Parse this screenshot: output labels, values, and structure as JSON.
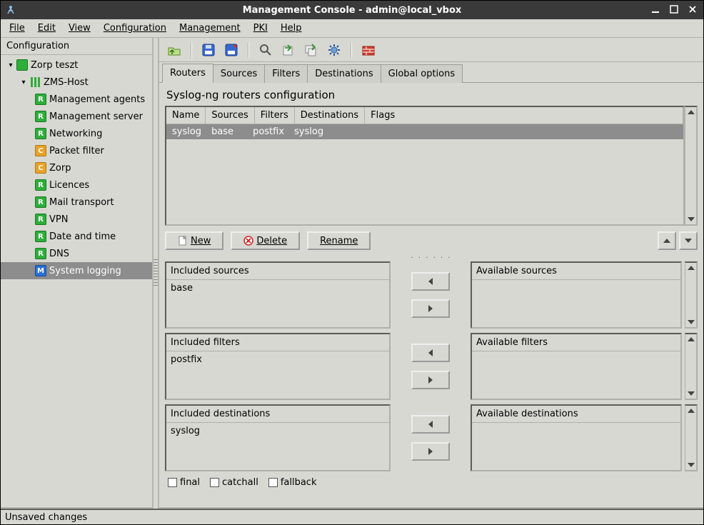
{
  "window_title": "Management Console - admin@local_vbox",
  "menubar": {
    "file": "File",
    "edit": "Edit",
    "view": "View",
    "configuration": "Configuration",
    "management": "Management",
    "pki": "PKI",
    "help": "Help"
  },
  "sidebar": {
    "header": "Configuration",
    "root": "Zorp teszt",
    "host": "ZMS-Host",
    "items": [
      {
        "icon": "R",
        "color": "green",
        "label": "Management agents"
      },
      {
        "icon": "R",
        "color": "green",
        "label": "Management server"
      },
      {
        "icon": "R",
        "color": "green",
        "label": "Networking"
      },
      {
        "icon": "C",
        "color": "orange",
        "label": "Packet filter"
      },
      {
        "icon": "C",
        "color": "orange",
        "label": "Zorp"
      },
      {
        "icon": "R",
        "color": "green",
        "label": "Licences"
      },
      {
        "icon": "R",
        "color": "green",
        "label": "Mail transport"
      },
      {
        "icon": "R",
        "color": "green",
        "label": "VPN"
      },
      {
        "icon": "R",
        "color": "green",
        "label": "Date and time"
      },
      {
        "icon": "R",
        "color": "green",
        "label": "DNS"
      },
      {
        "icon": "M",
        "color": "blue",
        "label": "System logging",
        "selected": true
      }
    ]
  },
  "toolbar": {
    "icons": [
      "up-folder",
      "save-blue",
      "save-red",
      "search",
      "export",
      "export-multi",
      "gear",
      "firewall"
    ]
  },
  "tabs": {
    "items": [
      "Routers",
      "Sources",
      "Filters",
      "Destinations",
      "Global options"
    ],
    "active": 0
  },
  "section_title": "Syslog-ng routers configuration",
  "table": {
    "columns": [
      "Name",
      "Sources",
      "Filters",
      "Destinations",
      "Flags"
    ],
    "rows": [
      {
        "name": "syslog",
        "sources": "base",
        "filters": "postfix",
        "destinations": "syslog",
        "flags": "",
        "selected": true
      }
    ]
  },
  "buttons": {
    "new": "New",
    "delete": "Delete",
    "rename": "Rename"
  },
  "transfer": {
    "included_sources_h": "Included sources",
    "included_sources": [
      "base"
    ],
    "available_sources_h": "Available sources",
    "available_sources": [],
    "included_filters_h": "Included filters",
    "included_filters": [
      "postfix"
    ],
    "available_filters_h": "Available filters",
    "available_filters": [],
    "included_destinations_h": "Included destinations",
    "included_destinations": [
      "syslog"
    ],
    "available_destinations_h": "Available destinations",
    "available_destinations": []
  },
  "flags": {
    "final": "final",
    "catchall": "catchall",
    "fallback": "fallback"
  },
  "status": "Unsaved changes"
}
